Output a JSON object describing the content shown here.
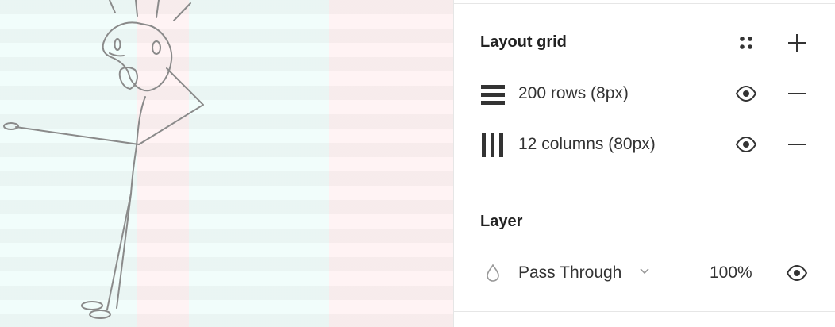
{
  "layout_grid": {
    "title": "Layout grid",
    "icons": {
      "styles": "grid-styles-icon",
      "add": "plus-icon"
    },
    "grids": [
      {
        "label": "200 rows (8px)",
        "type": "rows",
        "icon": "rows-grid-icon",
        "visible": true
      },
      {
        "label": "12 columns (80px)",
        "type": "columns",
        "icon": "columns-grid-icon",
        "visible": true
      }
    ]
  },
  "layer": {
    "title": "Layer",
    "blend_mode": "Pass Through",
    "blend_icon": "drop-icon",
    "opacity": "100%",
    "visible": true
  },
  "colors": {
    "text_primary": "#222222",
    "icon": "#333333",
    "divider": "#e6e6e6"
  }
}
